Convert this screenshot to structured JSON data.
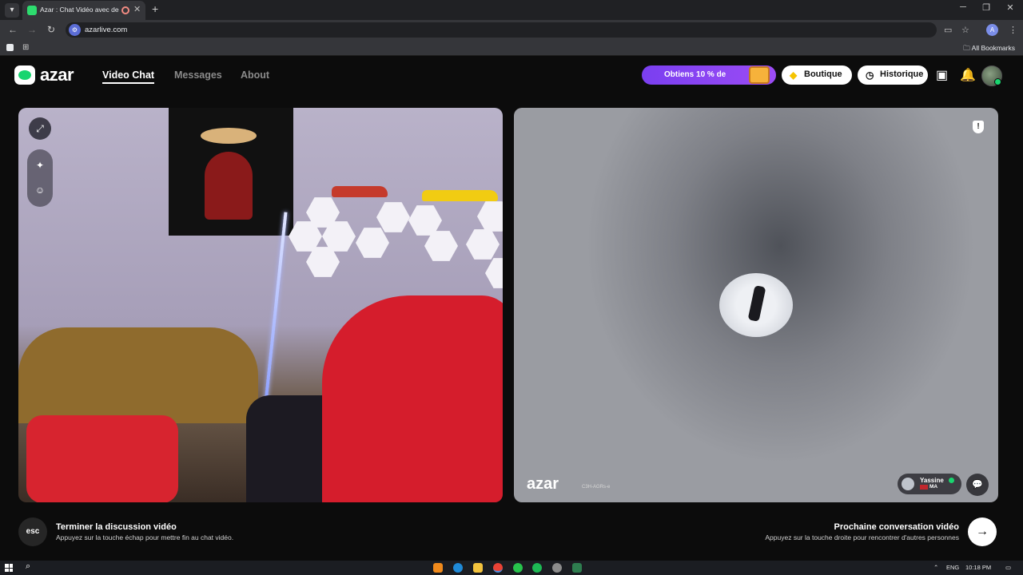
{
  "browser": {
    "tab_title": "Azar : Chat Vidéo avec de n",
    "url": "azarlive.com",
    "bookmarks_label": "All Bookmarks",
    "profile_initial": "A"
  },
  "site": {
    "logo_text": "azar",
    "nav": [
      "Video Chat",
      "Messages",
      "About"
    ],
    "promo_label": "Obtiens 10 % de",
    "boutique_label": "Boutique",
    "historique_label": "Historique"
  },
  "remote": {
    "watermark": "azar",
    "watermark_code": "C3H-AGRs-e",
    "user_name": "Yassine",
    "user_country": "MA"
  },
  "footer": {
    "esc_label": "esc",
    "end_title": "Terminer la discussion vidéo",
    "end_hint": "Appuyez sur la touche échap pour mettre fin au chat vidéo.",
    "next_title": "Prochaine conversation vidéo",
    "next_hint": "Appuyez sur la touche droite pour rencontrer d'autres personnes"
  },
  "taskbar": {
    "lang": "ENG",
    "time": "10:18 PM"
  },
  "colors": {
    "brand_green": "#19d56f",
    "promo_purple": "#8a44f2"
  }
}
